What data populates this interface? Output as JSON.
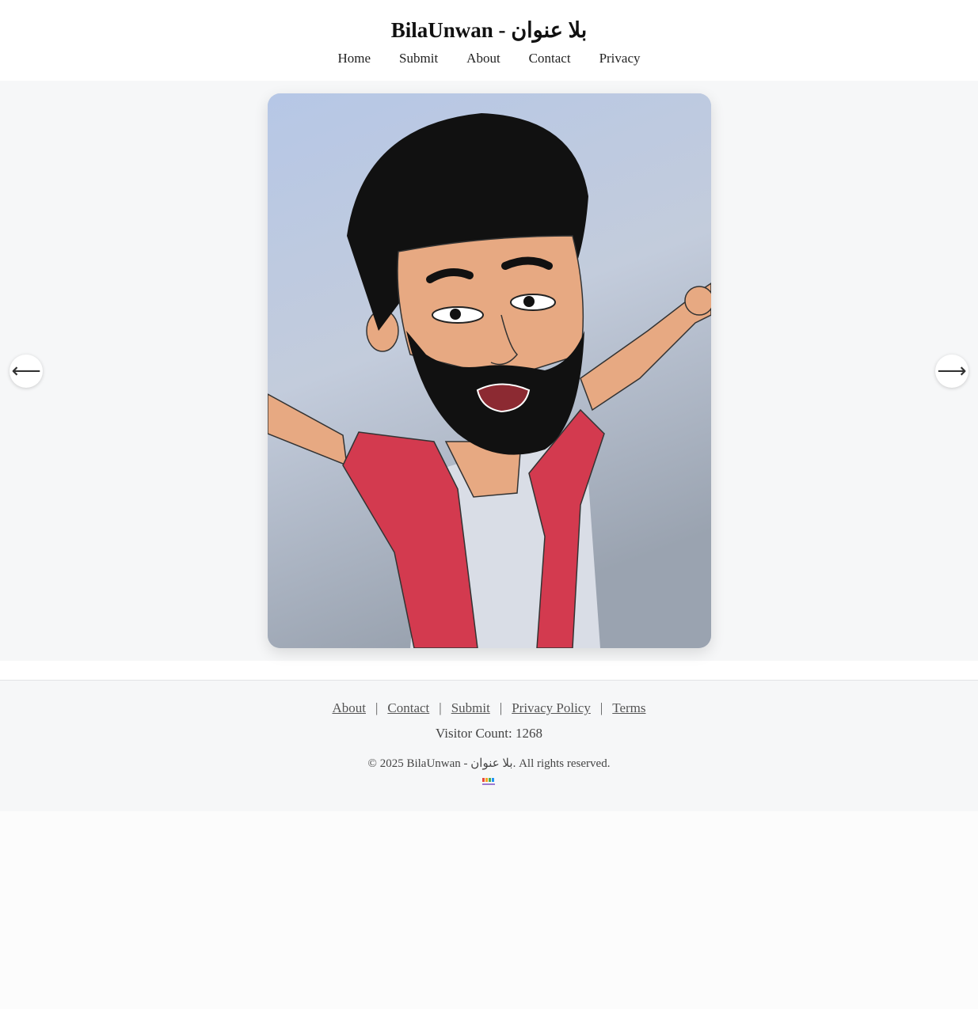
{
  "site": {
    "title": "BilaUnwan - بلا عنوان"
  },
  "nav": {
    "items": [
      "Home",
      "Submit",
      "About",
      "Contact",
      "Privacy"
    ]
  },
  "gallery": {
    "prev_arrow": "⟵",
    "next_arrow": "⟶"
  },
  "footer": {
    "links": [
      "About",
      "Contact",
      "Submit",
      "Privacy Policy",
      "Terms"
    ],
    "separator": "|",
    "visitor_count_text": "Visitor Count: 1268",
    "copyright": "© 2025 BilaUnwan - بلا عنوان. All rights reserved."
  },
  "colors": {
    "page_bg": "#fcfcfc",
    "gallery_bg": "#f6f7f8",
    "shirt_red": "#d33a4f",
    "skin": "#e7a982"
  }
}
